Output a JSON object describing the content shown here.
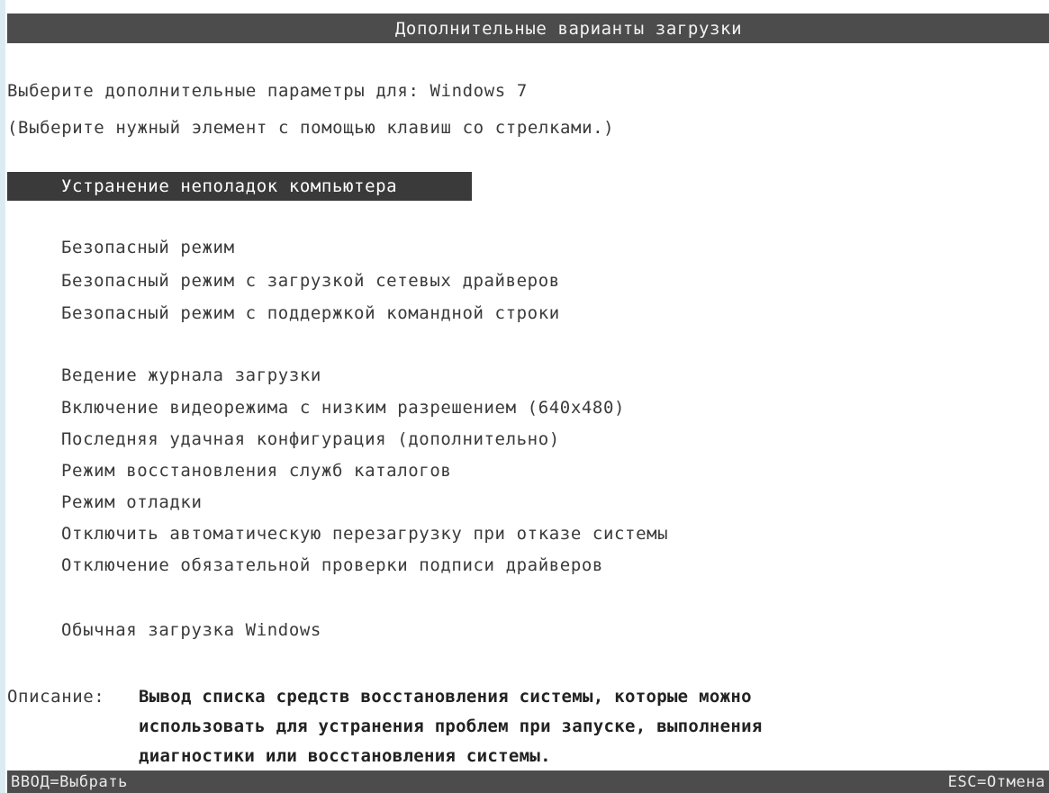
{
  "title": "Дополнительные варианты загрузки",
  "subtitle_line1": "Выберите дополнительные параметры для: Windows 7",
  "subtitle_line2": "(Выберите нужный элемент с помощью клавиш со стрелками.)",
  "selected_item": "Устранение неполадок компьютера",
  "group1": [
    "Безопасный режим",
    "Безопасный режим с загрузкой сетевых драйверов",
    "Безопасный режим с поддержкой командной строки"
  ],
  "group2": [
    "Ведение журнала загрузки",
    "Включение видеорежима с низким разрешением (640x480)",
    "Последняя удачная конфигурация (дополнительно)",
    "Режим восстановления служб каталогов",
    "Режим отладки",
    "Отключить автоматическую перезагрузку при отказе системы",
    "Отключение обязательной проверки подписи драйверов"
  ],
  "group3": [
    "Обычная загрузка Windows"
  ],
  "description": {
    "label": "Описание:",
    "lines": [
      "Вывод списка средств восстановления системы, которые можно",
      "использовать для устранения проблем при запуске, выполнения",
      "диагностики или восстановления системы."
    ]
  },
  "footer": {
    "left": "ВВОД=Выбрать",
    "right": "ESC=Отмена"
  },
  "colors": {
    "bar": "#4c4c4c",
    "selection": "#3a3a3a",
    "text": "#3a3a3a",
    "background": "#ffffff"
  }
}
